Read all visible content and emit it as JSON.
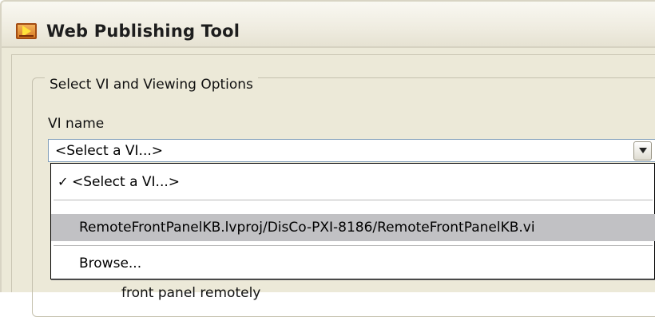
{
  "window": {
    "title": "Web Publishing Tool",
    "icon": "labview-vi-icon"
  },
  "group": {
    "label": "Select VI and Viewing Options"
  },
  "vi_name": {
    "label": "VI name",
    "selected_value": "<Select a VI...>",
    "options": [
      {
        "label": "<Select a VI...>",
        "checked": true
      },
      {
        "label": "RemoteFrontPanelKB.lvproj/DisCo-PXI-8186/RemoteFrontPanelKB.vi",
        "highlighted": true
      },
      {
        "label": "Browse..."
      }
    ]
  },
  "partial_text": "front panel remotely",
  "colors": {
    "window_bg": "#ece9d8",
    "highlight": "#c1c1c4",
    "combo_border": "#7f9db9"
  }
}
